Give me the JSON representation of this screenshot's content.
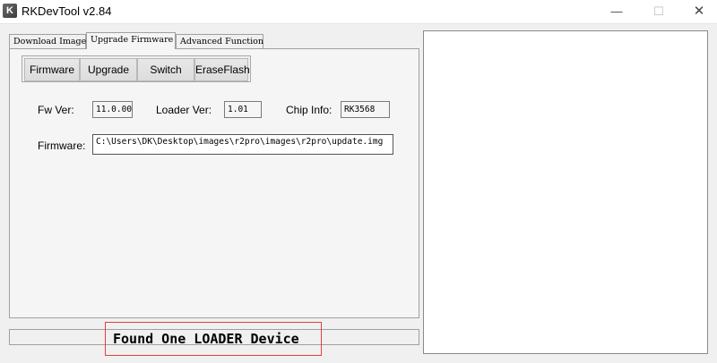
{
  "window": {
    "title": "RKDevTool v2.84",
    "minimize": "—",
    "maximize": "☐",
    "close": "✕"
  },
  "tabs": [
    {
      "label": "Download Image",
      "active": false
    },
    {
      "label": "Upgrade Firmware",
      "active": true
    },
    {
      "label": "Advanced Function",
      "active": false
    }
  ],
  "buttons": {
    "firmware": "Firmware",
    "upgrade": "Upgrade",
    "switch": "Switch",
    "erase_flash": "EraseFlash"
  },
  "info": {
    "fw_ver_label": "Fw Ver:",
    "fw_ver_value": "11.0.00",
    "loader_ver_label": "Loader Ver:",
    "loader_ver_value": "1.01",
    "chip_info_label": "Chip Info:",
    "chip_info_value": "RK3568",
    "firmware_label": "Firmware:",
    "firmware_path": "C:\\Users\\DK\\Desktop\\images\\r2pro\\images\\r2pro\\update.img"
  },
  "status": {
    "message": "Found One LOADER Device"
  }
}
